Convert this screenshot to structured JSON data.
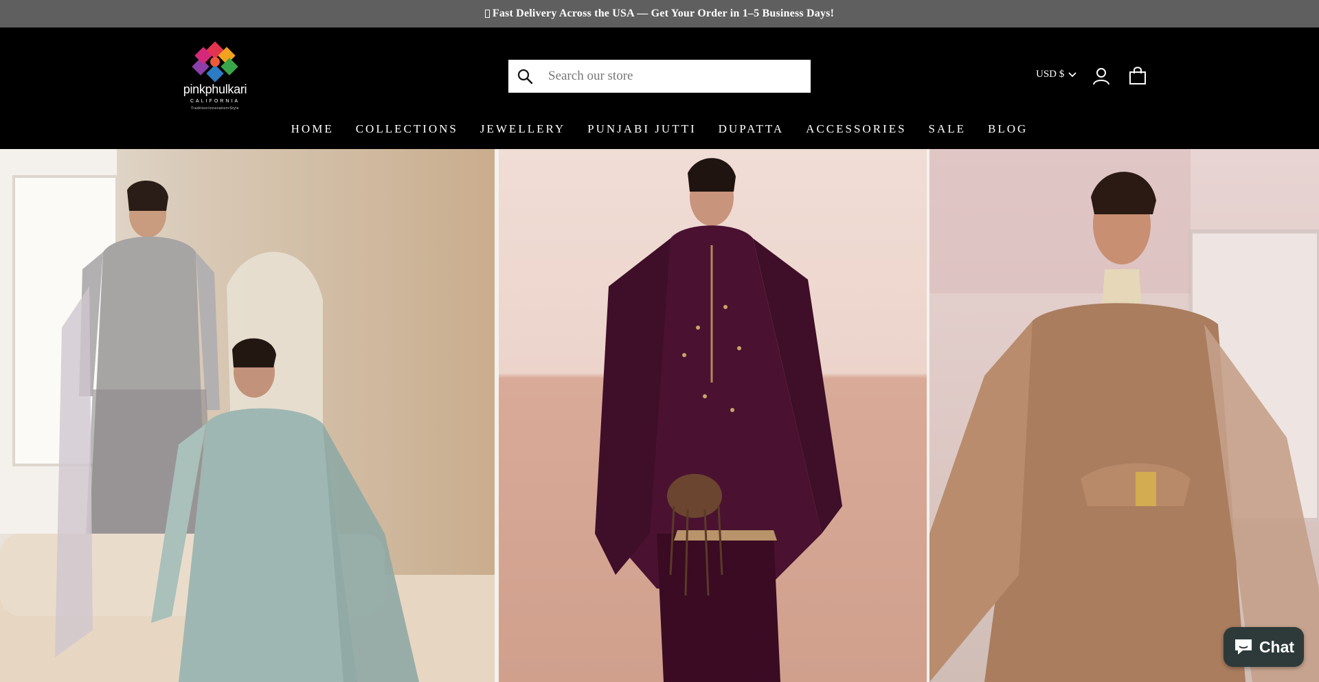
{
  "announcement": {
    "text": "Fast Delivery Across the USA — Get Your Order in 1–5 Business Days!"
  },
  "header": {
    "logo": {
      "name": "pinkphulkari",
      "sub": "CALIFORNIA",
      "tagline": "Tradition•Innovation•Style"
    },
    "search": {
      "placeholder": "Search our store",
      "icon": "search-icon"
    },
    "currency": {
      "label": "USD $",
      "icon": "chevron-down-icon"
    },
    "account": {
      "icon": "user-icon"
    },
    "cart": {
      "icon": "shopping-bag-icon"
    }
  },
  "nav": {
    "items": [
      {
        "label": "HOME"
      },
      {
        "label": "COLLECTIONS"
      },
      {
        "label": "JEWELLERY"
      },
      {
        "label": "PUNJABI JUTTI"
      },
      {
        "label": "DUPATTA"
      },
      {
        "label": "ACCESSORIES"
      },
      {
        "label": "SALE"
      },
      {
        "label": "BLOG"
      }
    ]
  },
  "hero": {
    "panels": [
      {
        "subject": "two models in embroidered grey and mint salwar suits"
      },
      {
        "subject": "model in plum velvet embroidered suit with potli bag"
      },
      {
        "subject": "model in caramel embroidered suit with dupatta"
      }
    ]
  },
  "chat": {
    "label": "Chat",
    "icon": "chat-bubble-icon"
  },
  "colors": {
    "announcement_bg": "#5f5f5f",
    "header_bg": "#000000",
    "chat_bg": "#2e3a3a"
  }
}
